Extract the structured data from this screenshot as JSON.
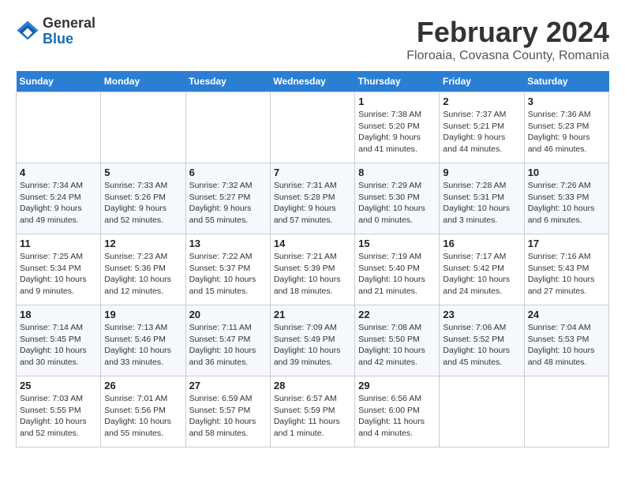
{
  "header": {
    "logo_general": "General",
    "logo_blue": "Blue",
    "month_title": "February 2024",
    "location": "Floroaia, Covasna County, Romania"
  },
  "weekdays": [
    "Sunday",
    "Monday",
    "Tuesday",
    "Wednesday",
    "Thursday",
    "Friday",
    "Saturday"
  ],
  "weeks": [
    [
      {
        "day": "",
        "info": ""
      },
      {
        "day": "",
        "info": ""
      },
      {
        "day": "",
        "info": ""
      },
      {
        "day": "",
        "info": ""
      },
      {
        "day": "1",
        "info": "Sunrise: 7:38 AM\nSunset: 5:20 PM\nDaylight: 9 hours\nand 41 minutes."
      },
      {
        "day": "2",
        "info": "Sunrise: 7:37 AM\nSunset: 5:21 PM\nDaylight: 9 hours\nand 44 minutes."
      },
      {
        "day": "3",
        "info": "Sunrise: 7:36 AM\nSunset: 5:23 PM\nDaylight: 9 hours\nand 46 minutes."
      }
    ],
    [
      {
        "day": "4",
        "info": "Sunrise: 7:34 AM\nSunset: 5:24 PM\nDaylight: 9 hours\nand 49 minutes."
      },
      {
        "day": "5",
        "info": "Sunrise: 7:33 AM\nSunset: 5:26 PM\nDaylight: 9 hours\nand 52 minutes."
      },
      {
        "day": "6",
        "info": "Sunrise: 7:32 AM\nSunset: 5:27 PM\nDaylight: 9 hours\nand 55 minutes."
      },
      {
        "day": "7",
        "info": "Sunrise: 7:31 AM\nSunset: 5:28 PM\nDaylight: 9 hours\nand 57 minutes."
      },
      {
        "day": "8",
        "info": "Sunrise: 7:29 AM\nSunset: 5:30 PM\nDaylight: 10 hours\nand 0 minutes."
      },
      {
        "day": "9",
        "info": "Sunrise: 7:28 AM\nSunset: 5:31 PM\nDaylight: 10 hours\nand 3 minutes."
      },
      {
        "day": "10",
        "info": "Sunrise: 7:26 AM\nSunset: 5:33 PM\nDaylight: 10 hours\nand 6 minutes."
      }
    ],
    [
      {
        "day": "11",
        "info": "Sunrise: 7:25 AM\nSunset: 5:34 PM\nDaylight: 10 hours\nand 9 minutes."
      },
      {
        "day": "12",
        "info": "Sunrise: 7:23 AM\nSunset: 5:36 PM\nDaylight: 10 hours\nand 12 minutes."
      },
      {
        "day": "13",
        "info": "Sunrise: 7:22 AM\nSunset: 5:37 PM\nDaylight: 10 hours\nand 15 minutes."
      },
      {
        "day": "14",
        "info": "Sunrise: 7:21 AM\nSunset: 5:39 PM\nDaylight: 10 hours\nand 18 minutes."
      },
      {
        "day": "15",
        "info": "Sunrise: 7:19 AM\nSunset: 5:40 PM\nDaylight: 10 hours\nand 21 minutes."
      },
      {
        "day": "16",
        "info": "Sunrise: 7:17 AM\nSunset: 5:42 PM\nDaylight: 10 hours\nand 24 minutes."
      },
      {
        "day": "17",
        "info": "Sunrise: 7:16 AM\nSunset: 5:43 PM\nDaylight: 10 hours\nand 27 minutes."
      }
    ],
    [
      {
        "day": "18",
        "info": "Sunrise: 7:14 AM\nSunset: 5:45 PM\nDaylight: 10 hours\nand 30 minutes."
      },
      {
        "day": "19",
        "info": "Sunrise: 7:13 AM\nSunset: 5:46 PM\nDaylight: 10 hours\nand 33 minutes."
      },
      {
        "day": "20",
        "info": "Sunrise: 7:11 AM\nSunset: 5:47 PM\nDaylight: 10 hours\nand 36 minutes."
      },
      {
        "day": "21",
        "info": "Sunrise: 7:09 AM\nSunset: 5:49 PM\nDaylight: 10 hours\nand 39 minutes."
      },
      {
        "day": "22",
        "info": "Sunrise: 7:08 AM\nSunset: 5:50 PM\nDaylight: 10 hours\nand 42 minutes."
      },
      {
        "day": "23",
        "info": "Sunrise: 7:06 AM\nSunset: 5:52 PM\nDaylight: 10 hours\nand 45 minutes."
      },
      {
        "day": "24",
        "info": "Sunrise: 7:04 AM\nSunset: 5:53 PM\nDaylight: 10 hours\nand 48 minutes."
      }
    ],
    [
      {
        "day": "25",
        "info": "Sunrise: 7:03 AM\nSunset: 5:55 PM\nDaylight: 10 hours\nand 52 minutes."
      },
      {
        "day": "26",
        "info": "Sunrise: 7:01 AM\nSunset: 5:56 PM\nDaylight: 10 hours\nand 55 minutes."
      },
      {
        "day": "27",
        "info": "Sunrise: 6:59 AM\nSunset: 5:57 PM\nDaylight: 10 hours\nand 58 minutes."
      },
      {
        "day": "28",
        "info": "Sunrise: 6:57 AM\nSunset: 5:59 PM\nDaylight: 11 hours\nand 1 minute."
      },
      {
        "day": "29",
        "info": "Sunrise: 6:56 AM\nSunset: 6:00 PM\nDaylight: 11 hours\nand 4 minutes."
      },
      {
        "day": "",
        "info": ""
      },
      {
        "day": "",
        "info": ""
      }
    ]
  ]
}
